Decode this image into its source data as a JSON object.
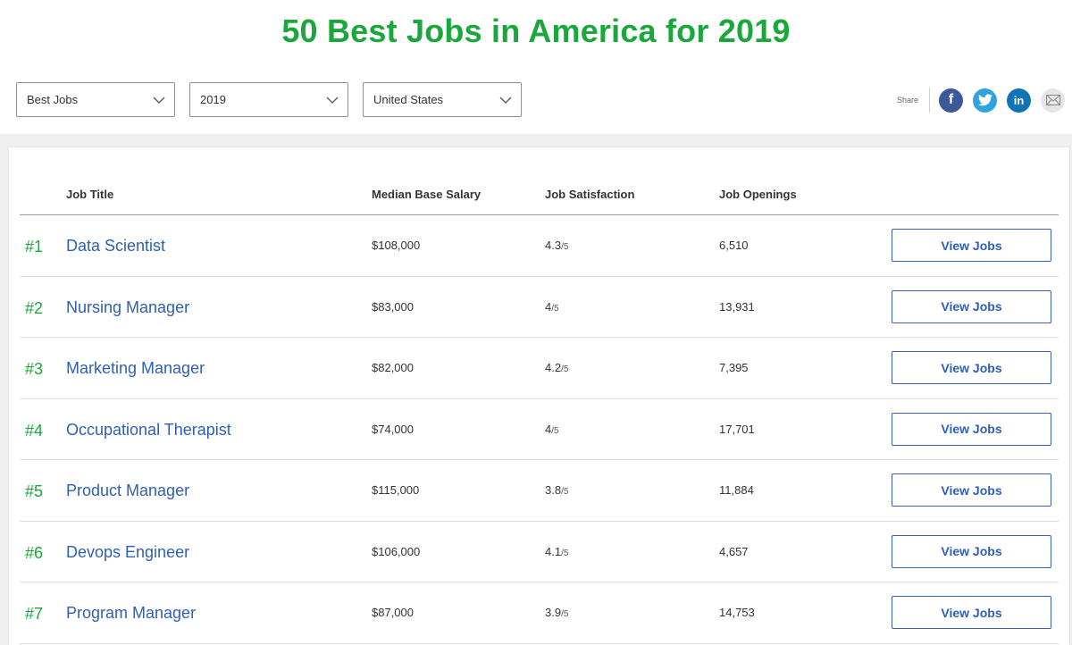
{
  "header": {
    "title": "50 Best Jobs in America for 2019"
  },
  "filters": [
    {
      "name": "category-select",
      "value": "Best Jobs"
    },
    {
      "name": "year-select",
      "value": "2019"
    },
    {
      "name": "country-select",
      "value": "United States"
    }
  ],
  "share": {
    "label": "Share",
    "icons": [
      "facebook-icon",
      "twitter-icon",
      "linkedin-icon",
      "email-icon"
    ],
    "colors": {
      "facebook": "#3b5998",
      "twitter": "#2ea3dd",
      "linkedin": "#0f74b6",
      "email": "#e6e6e6"
    }
  },
  "table": {
    "columns": {
      "job_title": "Job Title",
      "salary": "Median Base Salary",
      "satisfaction": "Job Satisfaction",
      "openings": "Job Openings"
    },
    "rows": [
      {
        "rank": "#1",
        "title": "Data Scientist",
        "salary": "$108,000",
        "satisfaction": "4.3",
        "satisfaction_denom": "/5",
        "openings": "6,510",
        "button": "View Jobs"
      },
      {
        "rank": "#2",
        "title": "Nursing Manager",
        "salary": "$83,000",
        "satisfaction": "4",
        "satisfaction_denom": "/5",
        "openings": "13,931",
        "button": "View Jobs"
      },
      {
        "rank": "#3",
        "title": "Marketing Manager",
        "salary": "$82,000",
        "satisfaction": "4.2",
        "satisfaction_denom": "/5",
        "openings": "7,395",
        "button": "View Jobs"
      },
      {
        "rank": "#4",
        "title": "Occupational Therapist",
        "salary": "$74,000",
        "satisfaction": "4",
        "satisfaction_denom": "/5",
        "openings": "17,701",
        "button": "View Jobs"
      },
      {
        "rank": "#5",
        "title": "Product Manager",
        "salary": "$115,000",
        "satisfaction": "3.8",
        "satisfaction_denom": "/5",
        "openings": "11,884",
        "button": "View Jobs"
      },
      {
        "rank": "#6",
        "title": "Devops Engineer",
        "salary": "$106,000",
        "satisfaction": "4.1",
        "satisfaction_denom": "/5",
        "openings": "4,657",
        "button": "View Jobs"
      },
      {
        "rank": "#7",
        "title": "Program Manager",
        "salary": "$87,000",
        "satisfaction": "3.9",
        "satisfaction_denom": "/5",
        "openings": "14,753",
        "button": "View Jobs"
      }
    ]
  },
  "colors": {
    "accent_green": "#1aa83c",
    "link_blue": "#2f5fb5",
    "button_border": "#3b5fb0"
  }
}
